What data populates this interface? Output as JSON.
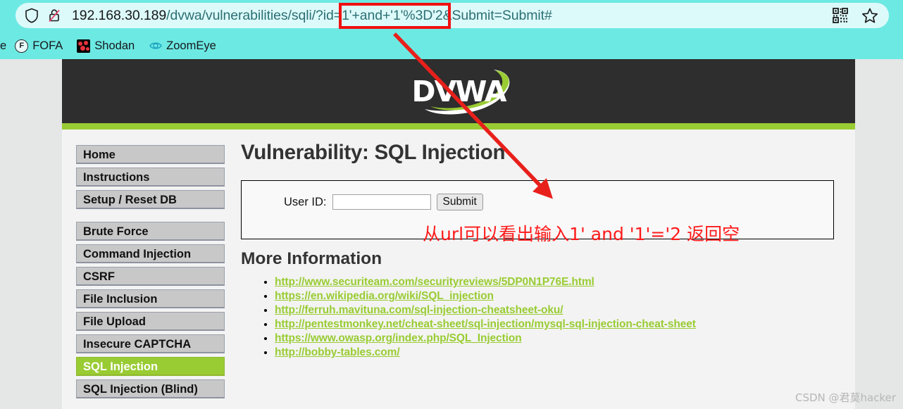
{
  "browser": {
    "url_host": "192.168.30.189",
    "url_path": "/dvwa/vulnerabilities/sqli/?id=",
    "url_highlighted": "1'+and+'1'%3D'2",
    "url_tail": "&Submit=Submit#",
    "url_full": "192.168.30.189/dvwa/vulnerabilities/sqli/?id=1'+and+'1'%3D'2&Submit=Submit#",
    "shield_icon": "shield-icon",
    "lock_icon": "lock-crossed-icon",
    "qr_icon": "qr-code-icon",
    "star_icon": "star-bookmark-icon",
    "bookmarks": [
      {
        "label": "e",
        "icon": "cut-off-bookmark-icon"
      },
      {
        "label": "FOFA",
        "icon": "fofa-icon"
      },
      {
        "label": "Shodan",
        "icon": "shodan-icon"
      },
      {
        "label": "ZoomEye",
        "icon": "zoomeye-icon"
      }
    ]
  },
  "site": {
    "logo_text": "DVWA",
    "accent_green": "#9c3",
    "header_bg": "#2e2e2e"
  },
  "sidebar": {
    "groups": [
      {
        "items": [
          {
            "label": "Home",
            "active": false
          },
          {
            "label": "Instructions",
            "active": false
          },
          {
            "label": "Setup / Reset DB",
            "active": false
          }
        ]
      },
      {
        "items": [
          {
            "label": "Brute Force",
            "active": false
          },
          {
            "label": "Command Injection",
            "active": false
          },
          {
            "label": "CSRF",
            "active": false
          },
          {
            "label": "File Inclusion",
            "active": false
          },
          {
            "label": "File Upload",
            "active": false
          },
          {
            "label": "Insecure CAPTCHA",
            "active": false
          },
          {
            "label": "SQL Injection",
            "active": true
          },
          {
            "label": "SQL Injection (Blind)",
            "active": false
          }
        ]
      }
    ]
  },
  "main": {
    "title": "Vulnerability: SQL Injection",
    "form": {
      "label": "User ID:",
      "input_value": "",
      "input_placeholder": "",
      "submit_label": "Submit"
    },
    "more_info_heading": "More Information",
    "links": [
      "http://www.securiteam.com/securityreviews/5DP0N1P76E.html",
      "https://en.wikipedia.org/wiki/SQL_injection",
      "http://ferruh.mavituna.com/sql-injection-cheatsheet-oku/",
      "http://pentestmonkey.net/cheat-sheet/sql-injection/mysql-sql-injection-cheat-sheet",
      "https://www.owasp.org/index.php/SQL_Injection",
      "http://bobby-tables.com/"
    ]
  },
  "annotations": {
    "red_note": "从url可以看出输入1' and '1'='2 返回空",
    "highlight_color": "#f01010",
    "arrow_color": "#e8201b"
  },
  "watermark": "CSDN @君莫hacker"
}
